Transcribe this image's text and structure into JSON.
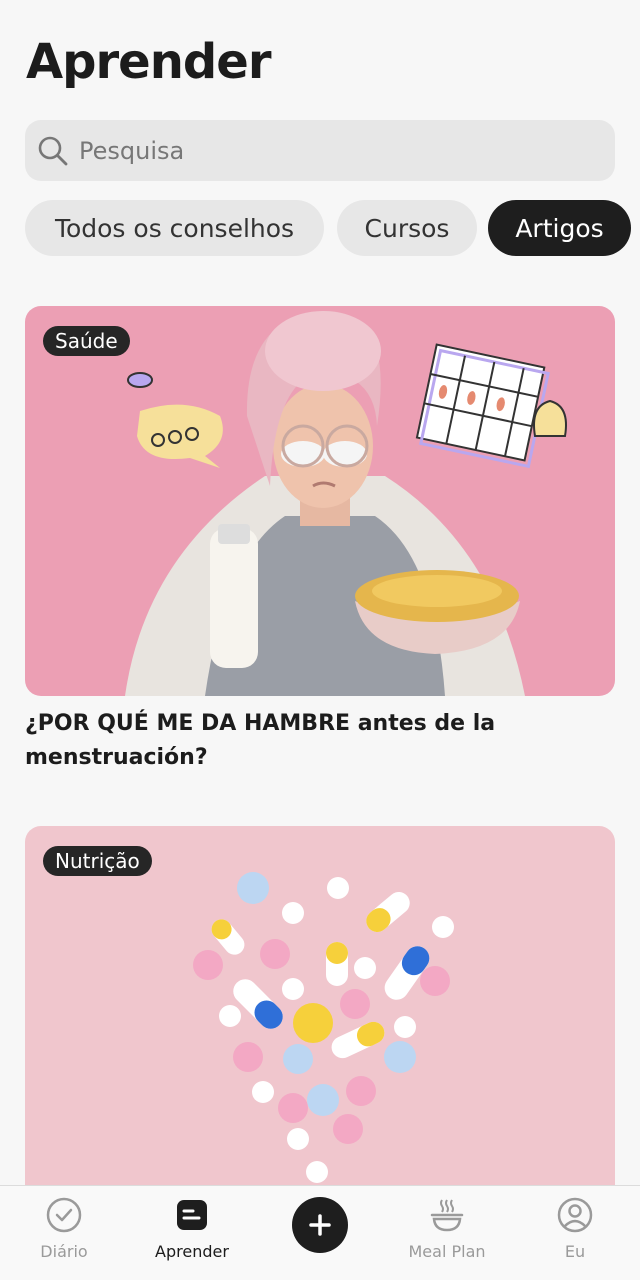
{
  "header": {
    "title": "Aprender"
  },
  "search": {
    "placeholder": "Pesquisa"
  },
  "filters": [
    {
      "label": "Todos os conselhos",
      "active": false
    },
    {
      "label": "Cursos",
      "active": false
    },
    {
      "label": "Artigos",
      "active": true
    }
  ],
  "articles": [
    {
      "category": "Saúde",
      "title": "¿POR QUÉ ME DA HAMBRE antes de la menstruación?",
      "image": "woman-with-milk-and-cereal"
    },
    {
      "category": "Nutrição",
      "title": "",
      "image": "pills-heart-shape"
    }
  ],
  "tabbar": {
    "items": [
      {
        "label": "Diário",
        "icon": "check-circle-icon"
      },
      {
        "label": "Aprender",
        "icon": "document-icon",
        "active": true
      },
      {
        "label": "",
        "icon": "plus-icon"
      },
      {
        "label": "Meal Plan",
        "icon": "bowl-icon"
      },
      {
        "label": "Eu",
        "icon": "profile-icon"
      }
    ]
  },
  "colors": {
    "background": "#f7f7f7",
    "chip_active": "#1e1e1e",
    "card1_bg": "#ec9fb4",
    "card2_bg": "#f0c6cd"
  }
}
